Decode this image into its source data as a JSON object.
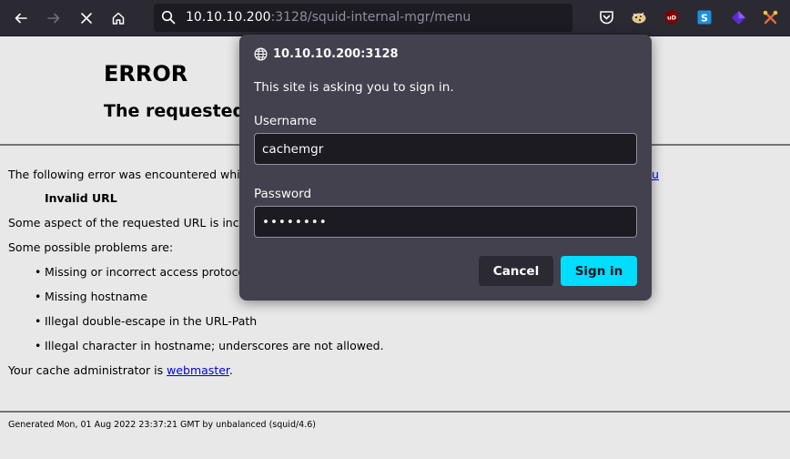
{
  "browser": {
    "url_host": "10.10.10.200",
    "url_rest": ":3128/squid-internal-mgr/menu"
  },
  "page": {
    "title": "ERROR",
    "subtitle": "The requested",
    "line1": "The following error was encountered while",
    "line1_link_tail": "u",
    "invalid_url": "Invalid URL",
    "line2": "Some aspect of the requested URL is incor",
    "line3": "Some possible problems are:",
    "bullets": [
      "Missing or incorrect access protocol",
      "Missing hostname",
      "Illegal double-escape in the URL-Path",
      "Illegal character in hostname; underscores are not allowed."
    ],
    "admin_prefix": "Your cache administrator is ",
    "admin_link": "webmaster",
    "admin_suffix": ".",
    "footer": "Generated Mon, 01 Aug 2022 23:37:21 GMT by unbalanced (squid/4.6)"
  },
  "dialog": {
    "origin": "10.10.10.200:3128",
    "message": "This site is asking you to sign in.",
    "username_label": "Username",
    "username_value": "cachemgr",
    "password_label": "Password",
    "password_value": "••••••••",
    "cancel_label": "Cancel",
    "signin_label": "Sign in"
  },
  "colors": {
    "accent": "#00ddff",
    "dialog_bg": "#42414d",
    "toolbar_bg": "#2b2a33"
  }
}
